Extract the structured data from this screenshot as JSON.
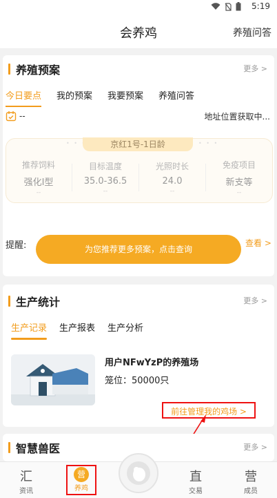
{
  "status": {
    "time": "5:19"
  },
  "header": {
    "title": "会养鸡",
    "qa_link": "养殖问答"
  },
  "plan": {
    "section_title": "养殖预案",
    "more": "更多 >",
    "tabs": [
      "今日要点",
      "我的预案",
      "我要预案",
      "养殖问答"
    ],
    "date_value": "--",
    "location": "地址位置获取中...",
    "breed_label": "京红1号-1日龄",
    "metrics": [
      {
        "label": "推荐饲料",
        "value": "强化I型",
        "sub": "--"
      },
      {
        "label": "目标温度",
        "value": "35.0-36.5",
        "sub": "--"
      },
      {
        "label": "光照时长",
        "value": "24.0",
        "sub": "--"
      },
      {
        "label": "免疫项目",
        "value": "新支等",
        "sub": "--"
      }
    ],
    "reminder_label": "提醒:",
    "cta_label": "为您推荐更多预案，点击查询",
    "view_link": "查看 >"
  },
  "production": {
    "section_title": "生产统计",
    "more": "更多 >",
    "tabs": [
      "生产记录",
      "生产报表",
      "生产分析"
    ],
    "farm_name": "用户NFwYzP的养殖场",
    "cage_label": "笼位：50000只",
    "manage_link": "前往管理我的鸡场 >"
  },
  "vet": {
    "section_title": "智慧兽医",
    "more": "更多 >"
  },
  "bottom_nav": [
    {
      "label": "资讯",
      "icon": "news-icon"
    },
    {
      "label": "养鸡",
      "icon": "chicken-icon"
    },
    {
      "label": "",
      "icon": "center-logo-icon"
    },
    {
      "label": "交易",
      "icon": "trade-icon"
    },
    {
      "label": "成员",
      "icon": "members-icon"
    }
  ],
  "colors": {
    "accent": "#f29c1c",
    "highlight": "#e11111"
  }
}
